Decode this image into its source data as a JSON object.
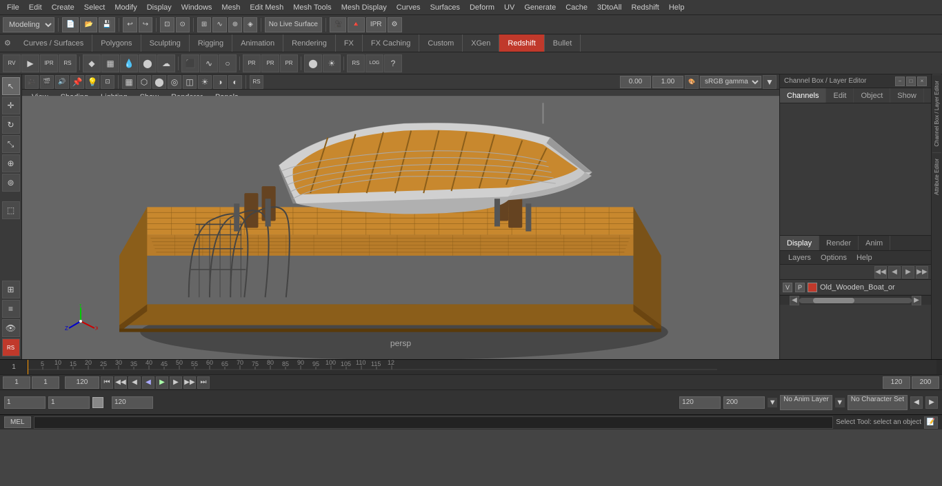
{
  "menubar": {
    "items": [
      "File",
      "Edit",
      "Create",
      "Select",
      "Modify",
      "Display",
      "Windows",
      "Mesh",
      "Edit Mesh",
      "Mesh Tools",
      "Mesh Display",
      "Curves",
      "Surfaces",
      "Deform",
      "UV",
      "Generate",
      "Cache",
      "3DtoAll",
      "Redshift",
      "Help"
    ]
  },
  "toolbar1": {
    "workspace": "Modeling",
    "no_live_label": "No Live Surface"
  },
  "tabs": {
    "items": [
      "Curves / Surfaces",
      "Polygons",
      "Sculpting",
      "Rigging",
      "Animation",
      "Rendering",
      "FX",
      "FX Caching",
      "Custom",
      "XGen",
      "Redshift",
      "Bullet"
    ]
  },
  "viewport": {
    "menus": [
      "View",
      "Shading",
      "Lighting",
      "Show",
      "Renderer",
      "Panels"
    ],
    "label": "persp",
    "color_value": "0.00",
    "value2": "1.00",
    "color_space": "sRGB gamma"
  },
  "channel_box": {
    "title": "Channel Box / Layer Editor",
    "tabs": [
      "Channels",
      "Edit",
      "Object",
      "Show"
    ]
  },
  "display_render": {
    "tabs": [
      "Display",
      "Render",
      "Anim"
    ]
  },
  "layers": {
    "menus": [
      "Layers",
      "Options",
      "Help"
    ],
    "item": {
      "v": "V",
      "p": "P",
      "name": "Old_Wooden_Boat_or"
    }
  },
  "timeline": {
    "start": "1",
    "end": "120",
    "current": "1",
    "range_end": "120",
    "max": "200",
    "ticks": [
      "5",
      "10",
      "15",
      "20",
      "25",
      "30",
      "35",
      "40",
      "45",
      "50",
      "55",
      "60",
      "65",
      "70",
      "75",
      "80",
      "85",
      "90",
      "95",
      "100",
      "105",
      "110",
      "115",
      "12"
    ]
  },
  "playback": {
    "frame_start": "1",
    "frame_current": "1",
    "frame_end": "120",
    "range_end": "120",
    "max_end": "200"
  },
  "statusbar": {
    "frame_field1": "1",
    "frame_field2": "1",
    "range1": "120",
    "range2": "120",
    "max": "200",
    "no_anim_layer": "No Anim Layer",
    "no_char_set": "No Character Set"
  },
  "cmdline": {
    "lang": "MEL",
    "status": "Select Tool: select an object"
  },
  "icons": {
    "gear": "⚙",
    "arrow_left": "◀",
    "arrow_right": "▶",
    "play": "▶",
    "stop": "■",
    "skip_end": "⏭",
    "skip_start": "⏮",
    "prev_frame": "◀",
    "next_frame": "▶",
    "undo": "↩",
    "redo": "↪",
    "plus": "+",
    "minus": "-",
    "x": "✕"
  }
}
